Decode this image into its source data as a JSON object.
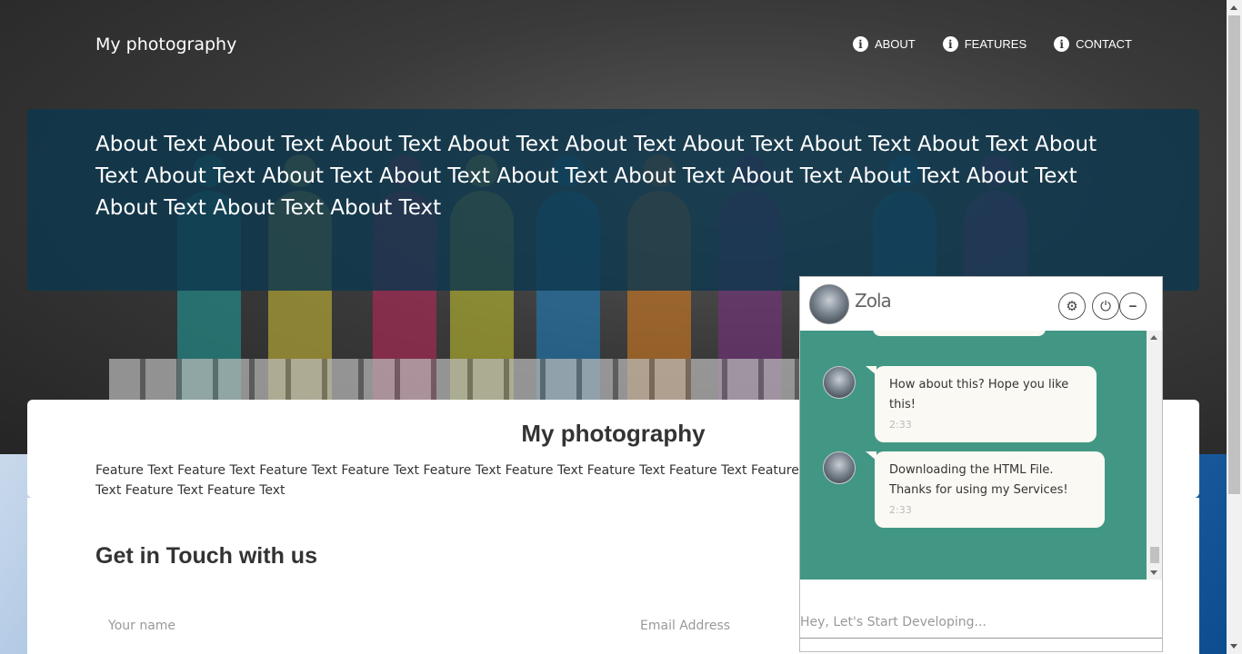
{
  "header": {
    "brand": "My photography",
    "nav": [
      {
        "label": "ABOUT",
        "icon": "info-icon"
      },
      {
        "label": "FEATURES",
        "icon": "info-icon"
      },
      {
        "label": "CONTACT",
        "icon": "info-icon"
      }
    ]
  },
  "about": {
    "text": "About Text About Text About Text About Text About Text About Text About Text About Text About Text About Text About Text About Text About Text About Text About Text About Text About Text About Text About Text About Text"
  },
  "features": {
    "title": "My photography",
    "text": "Feature Text Feature Text Feature Text Feature Text Feature Text Feature Text Feature Text Feature Text Feature Text Feature Text Feature Text Feature Text Feature Text Feature Text Feature Text"
  },
  "contact": {
    "title": "Get in Touch with us",
    "name_placeholder": "Your name",
    "email_placeholder": "Email Address"
  },
  "chat": {
    "bot_name": "Zola",
    "messages": [
      {
        "text": "How about this? Hope you like this!",
        "time": "2:33"
      },
      {
        "text": "Downloading the HTML File. Thanks for using my Services!",
        "time": "2:33"
      }
    ],
    "input_placeholder": "Hey, Let's Start Developing...",
    "accent_color": "#419784"
  },
  "colors": {
    "about_panel": "#0e374e",
    "band": "#2e6fb0"
  }
}
